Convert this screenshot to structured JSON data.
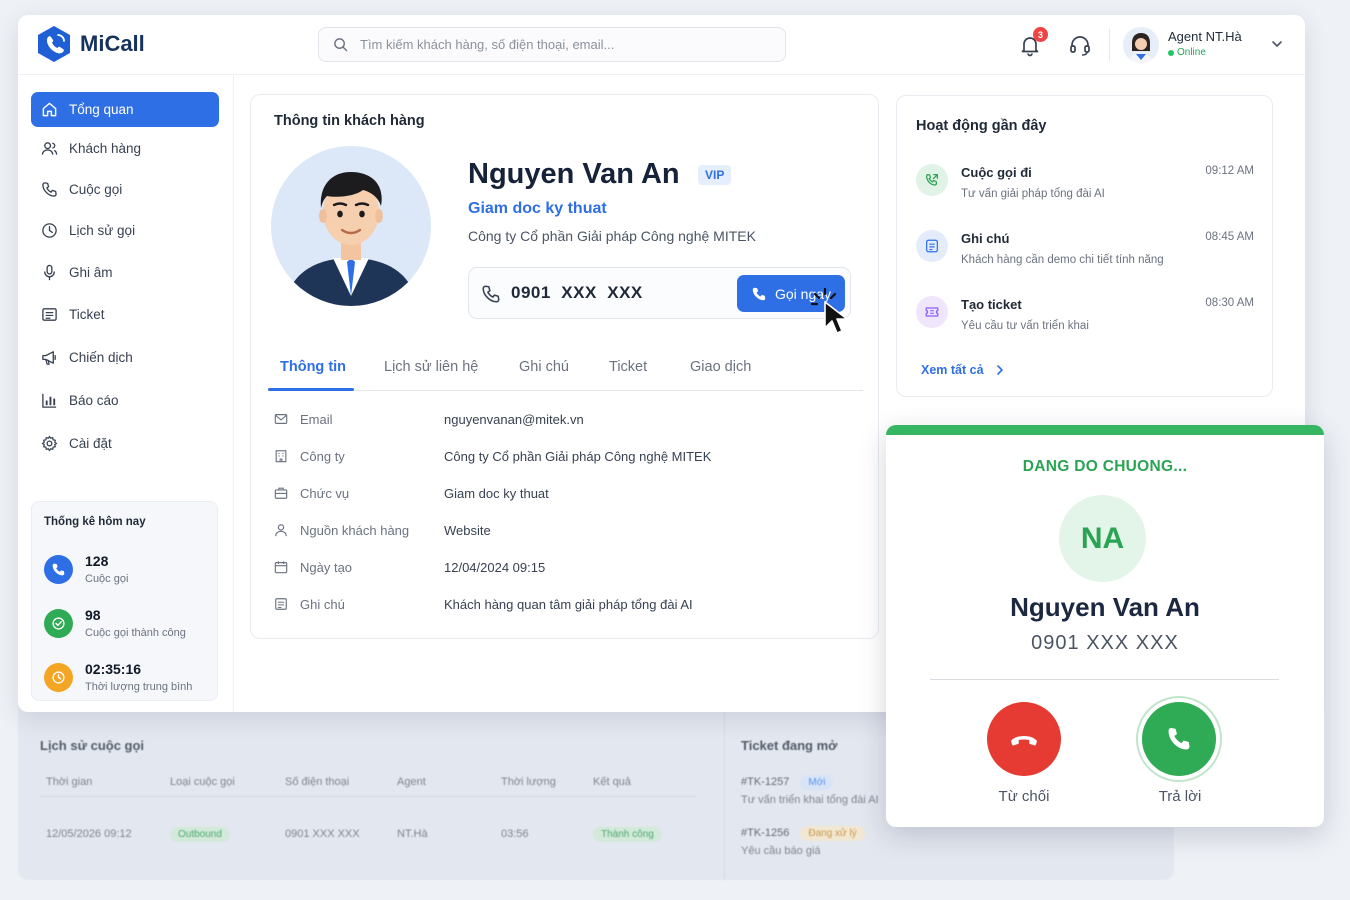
{
  "app": {
    "name": "MiCall"
  },
  "search": {
    "placeholder": "Tìm kiếm khách hàng, số điện thoại, email..."
  },
  "header": {
    "notification_count": "3",
    "agent_name": "Agent NT.Hà",
    "agent_status": "Online"
  },
  "sidebar": {
    "items": [
      {
        "label": "Tổng quan",
        "icon": "home-icon",
        "active": true
      },
      {
        "label": "Khách hàng",
        "icon": "users-icon"
      },
      {
        "label": "Cuộc gọi",
        "icon": "phone-icon"
      },
      {
        "label": "Lịch sử gọi",
        "icon": "clock-icon"
      },
      {
        "label": "Ghi âm",
        "icon": "microphone-icon"
      },
      {
        "label": "Ticket",
        "icon": "ticket-icon"
      },
      {
        "label": "Chiến dịch",
        "icon": "megaphone-icon"
      },
      {
        "label": "Báo cáo",
        "icon": "bar-chart-icon"
      },
      {
        "label": "Cài đặt",
        "icon": "gear-icon"
      }
    ],
    "stats": {
      "title": "Thống kê hôm nay",
      "items": [
        {
          "value": "128",
          "label": "Cuộc gọi",
          "color": "#2f6fe6"
        },
        {
          "value": "98",
          "label": "Cuộc gọi thành công",
          "color": "#2faa55"
        },
        {
          "value": "02:35:16",
          "label": "Thời lượng trung bình",
          "color": "#f5a524"
        }
      ]
    }
  },
  "customer": {
    "section_title": "Thông tin khách hàng",
    "name": "Nguyen Van An",
    "badge": "VIP",
    "job_title": "Giam doc ky thuat",
    "company": "Công ty Cổ phần Giải pháp Công nghệ MITEK",
    "phone": "0901  XXX  XXX",
    "call_button": "Gọi ngay",
    "tabs": [
      "Thông tin",
      "Lịch sử liên hệ",
      "Ghi chú",
      "Ticket",
      "Giao dịch"
    ],
    "fields": [
      {
        "label": "Email",
        "value": "nguyenvanan@mitek.vn",
        "icon": "mail-icon"
      },
      {
        "label": "Công ty",
        "value": "Công ty Cổ phần Giải pháp Công nghệ MITEK",
        "icon": "building-icon"
      },
      {
        "label": "Chức vụ",
        "value": "Giam doc ky thuat",
        "icon": "briefcase-icon"
      },
      {
        "label": "Nguồn khách hàng",
        "value": "Website",
        "icon": "user-icon"
      },
      {
        "label": "Ngày tạo",
        "value": "12/04/2024 09:15",
        "icon": "calendar-icon"
      },
      {
        "label": "Ghi chú",
        "value": "Khách hàng quan tâm giải pháp tổng đài AI",
        "icon": "note-icon"
      }
    ]
  },
  "activity": {
    "title": "Hoạt động gần đây",
    "items": [
      {
        "name": "Cuộc gọi đi",
        "desc": "Tư vấn giải pháp tổng đài AI",
        "time": "09:12 AM",
        "icon": "outgoing-call-icon"
      },
      {
        "name": "Ghi chú",
        "desc": "Khách hàng cần demo chi tiết tính năng",
        "time": "08:45 AM",
        "icon": "note-icon"
      },
      {
        "name": "Tạo ticket",
        "desc": "Yêu cầu tư vấn triển khai",
        "time": "08:30 AM",
        "icon": "ticket-icon"
      }
    ],
    "see_all": "Xem tất cả"
  },
  "incoming_call": {
    "status": "DANG DO CHUONG...",
    "initials": "NA",
    "name": "Nguyen Van An",
    "phone": "0901 XXX XXX",
    "decline": "Từ chối",
    "accept": "Trả lời"
  },
  "call_history": {
    "title": "Lịch sử cuộc gọi",
    "columns": [
      "Thời gian",
      "Loại cuộc gọi",
      "Số điện thoại",
      "Agent",
      "Thời lượng",
      "Kết quả"
    ],
    "rows": [
      {
        "time": "12/05/2026 09:12",
        "type": "Outbound",
        "phone": "0901 XXX XXX",
        "agent": "NT.Hà",
        "duration": "03:56",
        "result": "Thành công"
      }
    ]
  },
  "open_tickets": {
    "title": "Ticket đang mở",
    "items": [
      {
        "id": "#TK-1257",
        "status": "Mới",
        "desc": "Tư vấn triển khai tổng đài AI"
      },
      {
        "id": "#TK-1256",
        "status": "Đang xử lý",
        "desc": "Yêu cầu báo giá"
      }
    ]
  }
}
